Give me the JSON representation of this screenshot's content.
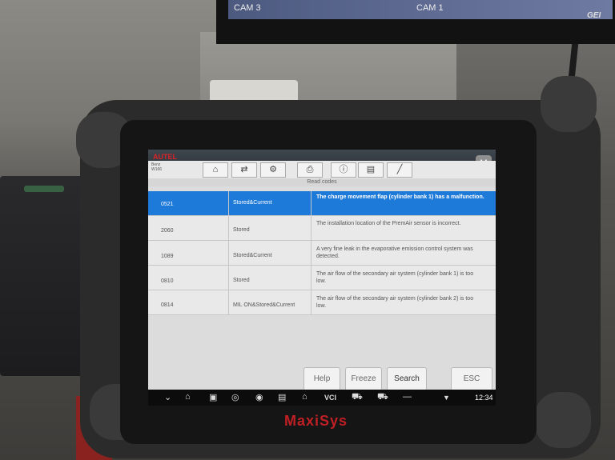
{
  "monitor": {
    "cam_left": "CAM 3",
    "cam_right": "CAM 1",
    "corner_text": "GEI"
  },
  "device": {
    "brand_top": "AUTEL",
    "brand_bottom": "MaxiSys"
  },
  "app": {
    "breadcrumb": [
      "Benz",
      "W166"
    ],
    "screen_title": "Read codes",
    "menu_badge": "M",
    "toolbar_icons": [
      "home-icon",
      "vehicle-swap-icon",
      "settings-icon",
      "print-icon",
      "help-icon",
      "save-icon",
      "edit-icon"
    ]
  },
  "codes": [
    {
      "code": "0521",
      "status": "Stored&Current",
      "description": "The charge movement flap (cylinder bank 1) has a malfunction.",
      "selected": true
    },
    {
      "code": "2060",
      "status": "Stored",
      "description": "The installation location of the PremAir sensor is incorrect.",
      "selected": false
    },
    {
      "code": "1089",
      "status": "Stored&Current",
      "description": "A very fine leak in the evaporative emission control system was detected.",
      "selected": false
    },
    {
      "code": "0810",
      "status": "Stored",
      "description": "The air flow of the secondary air system (cylinder bank 1) is too low.",
      "selected": false
    },
    {
      "code": "0814",
      "status": "MIL ON&Stored&Current",
      "description": "The air flow of the secondary air system (cylinder bank 2) is too low.",
      "selected": false
    }
  ],
  "buttons": {
    "help": "Help",
    "freeze": "Freeze",
    "search": "Search",
    "esc": "ESC"
  },
  "statusbar": {
    "time": "12:34"
  },
  "colors": {
    "selected_row": "#1e7ad8",
    "brand_red": "#c01f24"
  }
}
